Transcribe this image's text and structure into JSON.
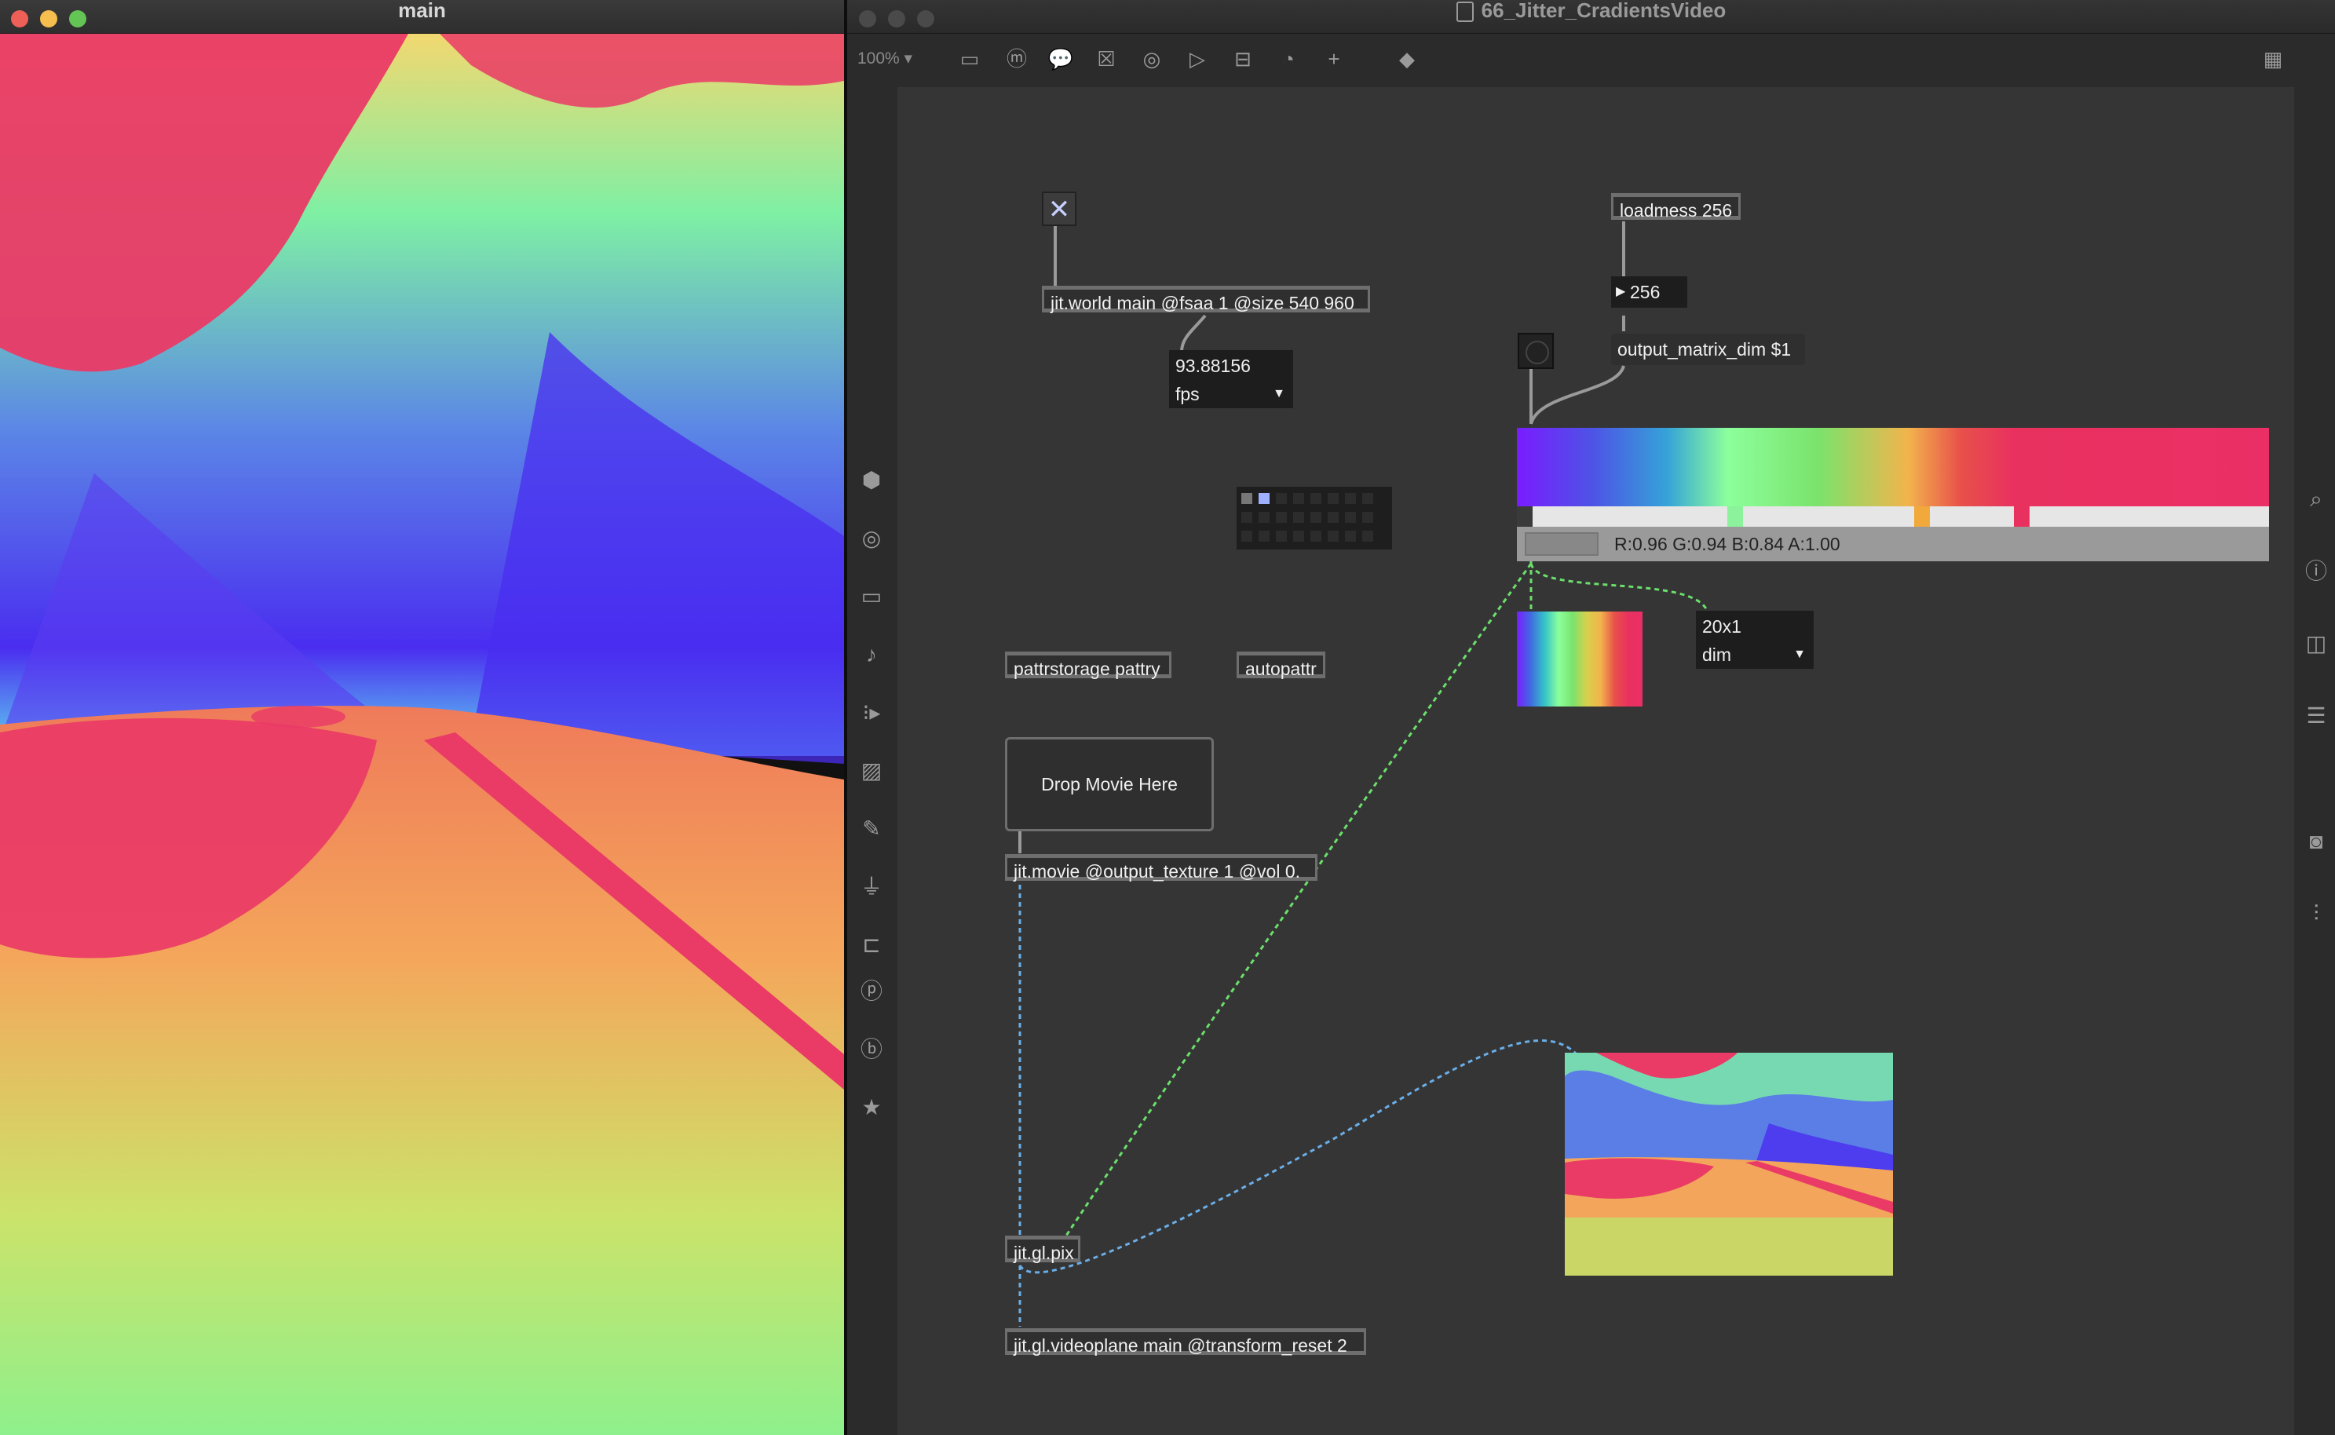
{
  "main_window": {
    "title": "main",
    "traffic_lights": {
      "close": "#ed5f57",
      "minimize": "#f5be4f",
      "zoom": "#62c554"
    }
  },
  "patcher": {
    "title": "66_Jitter_CradientsVideo",
    "title_icon": "document-icon",
    "zoom": "100% ▾",
    "toolbar_icons": [
      "new-object-icon",
      "message-icon",
      "comment-icon",
      "button-icon",
      "toggle-icon",
      "bang-icon",
      "slider-icon",
      "dial-icon",
      "add-icon",
      "paint-bucket-icon",
      "grid-icon"
    ],
    "left_sidebar_icons": [
      "cube-icon",
      "circle-target-icon",
      "film-icon",
      "music-icon",
      "dotted-arrow-icon",
      "image-icon",
      "pencil-icon",
      "plug-icon",
      "connector-icon",
      "p-icon",
      "b-icon",
      "star-icon"
    ],
    "right_sidebar_icons": [
      "search-icon",
      "info-icon",
      "columns-icon",
      "list-icon",
      "camera-icon",
      "sliders-icon"
    ]
  },
  "objects": {
    "jit_world": "jit.world main @fsaa 1 @size 540 960",
    "fps_value": "93.88156",
    "fps_menu": "fps",
    "loadmess": "loadmess 256",
    "num_256": "256",
    "output_matrix_msg": "output_matrix_dim $1",
    "pattrstorage": "pattrstorage pattry",
    "autopattr": "autopattr",
    "drop_movie": "Drop Movie Here",
    "jit_movie": "jit.movie @output_texture 1 @vol 0.",
    "jit_gl_pix": "jit.gl.pix",
    "jit_gl_videoplane": "jit.gl.videoplane main @transform_reset 2",
    "dim_value": "20x1",
    "dim_menu": "dim",
    "gradient_status": "R:0.96 G:0.94 B:0.84 A:1.00",
    "toggle_symbol": "✕"
  },
  "colors": {
    "gradient_handles": [
      "#8cf29c",
      "#f2a93b",
      "#e9315f"
    ],
    "wire_green": "#6bdf6b",
    "wire_blue": "#6aaee8"
  }
}
